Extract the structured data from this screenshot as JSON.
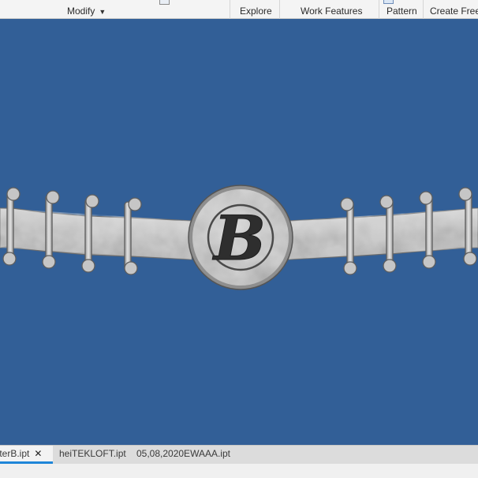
{
  "ribbon": {
    "modify": "Modify",
    "explore": "Explore",
    "work_features": "Work Features",
    "pattern": "Pattern",
    "create_freeform": "Create Freef"
  },
  "viewport": {
    "background": "#325f97",
    "emblem_letter": "B"
  },
  "doc_tabs": [
    {
      "label": "tterB.ipt",
      "active": true
    },
    {
      "label": "heiTEKLOFT.ipt",
      "active": false
    },
    {
      "label": "05,08,2020EWAAA.ipt",
      "active": false
    }
  ],
  "colors": {
    "accent": "#1f86d8",
    "metal": "#b9b9b9",
    "metal_edge": "#6c6c6c"
  }
}
